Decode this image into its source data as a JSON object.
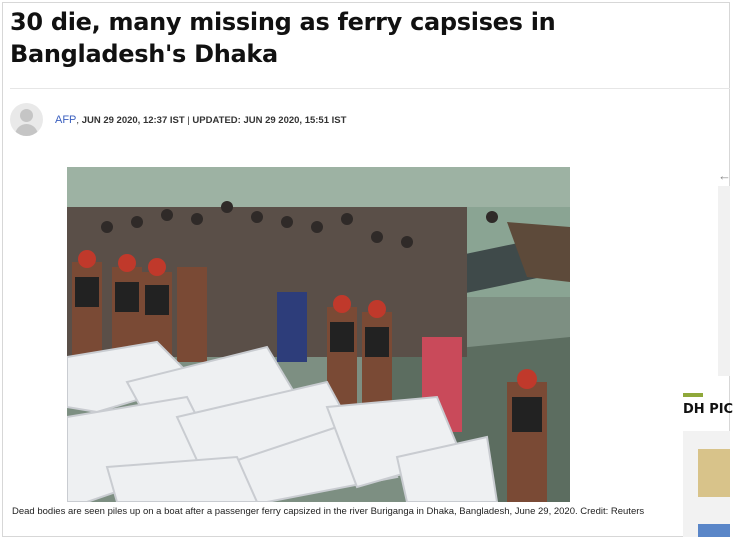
{
  "article": {
    "headline": "30 die, many missing as ferry capsises in Bangladesh's Dhaka",
    "author": "AFP",
    "published": "JUN 29 2020, 12:37 IST",
    "separator": "|",
    "updated": "UPDATED: JUN 29 2020, 15:51 IST",
    "photo_caption": "Dead bodies are seen piles up on a boat after a passenger ferry capsized in the river Buriganga in Dhaka, Bangladesh, June 29, 2020. Credit: Reuters"
  },
  "sidebar": {
    "arrow_icon": "chevron-left-icon",
    "section_title": "DH PICK"
  },
  "colors": {
    "author_link": "#3a5fbf",
    "accent": "#8fa83a"
  }
}
